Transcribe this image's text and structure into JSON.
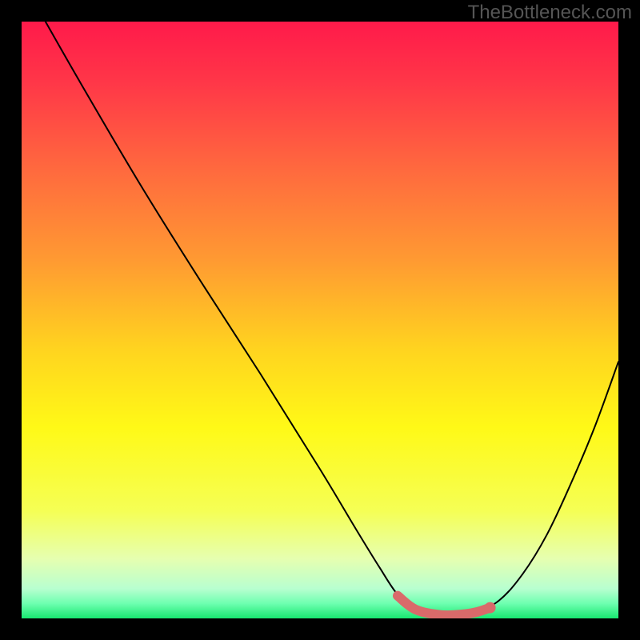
{
  "watermark": "TheBottleneck.com",
  "chart_data": {
    "type": "line",
    "title": "",
    "xlabel": "",
    "ylabel": "",
    "xlim": [
      0,
      100
    ],
    "ylim": [
      0,
      100
    ],
    "background_gradient": {
      "stops": [
        {
          "offset": 0.0,
          "color": "#ff1a4a"
        },
        {
          "offset": 0.1,
          "color": "#ff3648"
        },
        {
          "offset": 0.25,
          "color": "#ff6a3e"
        },
        {
          "offset": 0.4,
          "color": "#ff9a32"
        },
        {
          "offset": 0.55,
          "color": "#ffd41f"
        },
        {
          "offset": 0.68,
          "color": "#fff917"
        },
        {
          "offset": 0.82,
          "color": "#f5ff55"
        },
        {
          "offset": 0.9,
          "color": "#e6ffb0"
        },
        {
          "offset": 0.95,
          "color": "#b8ffd0"
        },
        {
          "offset": 0.975,
          "color": "#6effb0"
        },
        {
          "offset": 1.0,
          "color": "#18e870"
        }
      ]
    },
    "series": [
      {
        "name": "bottleneck-curve",
        "color": "#000000",
        "width": 2,
        "x": [
          4,
          10,
          20,
          30,
          40,
          50,
          56,
          60,
          63,
          66,
          70,
          73,
          76,
          80,
          84,
          88,
          92,
          96,
          100
        ],
        "values": [
          100,
          89.5,
          72.5,
          56.5,
          41,
          25,
          15,
          8.5,
          4,
          1.5,
          0.5,
          0.5,
          1,
          3,
          7.5,
          14,
          22.5,
          32,
          43
        ]
      }
    ],
    "highlight_segment": {
      "name": "optimal-range",
      "color": "#d96a6a",
      "width": 12,
      "cap": "round",
      "x": [
        63,
        66,
        70,
        73,
        76,
        78.5
      ],
      "values": [
        3.8,
        1.5,
        0.6,
        0.6,
        1.0,
        1.8
      ]
    },
    "highlight_end_dot": {
      "x": 78.5,
      "y": 1.8,
      "r": 7,
      "color": "#d96a6a"
    }
  }
}
